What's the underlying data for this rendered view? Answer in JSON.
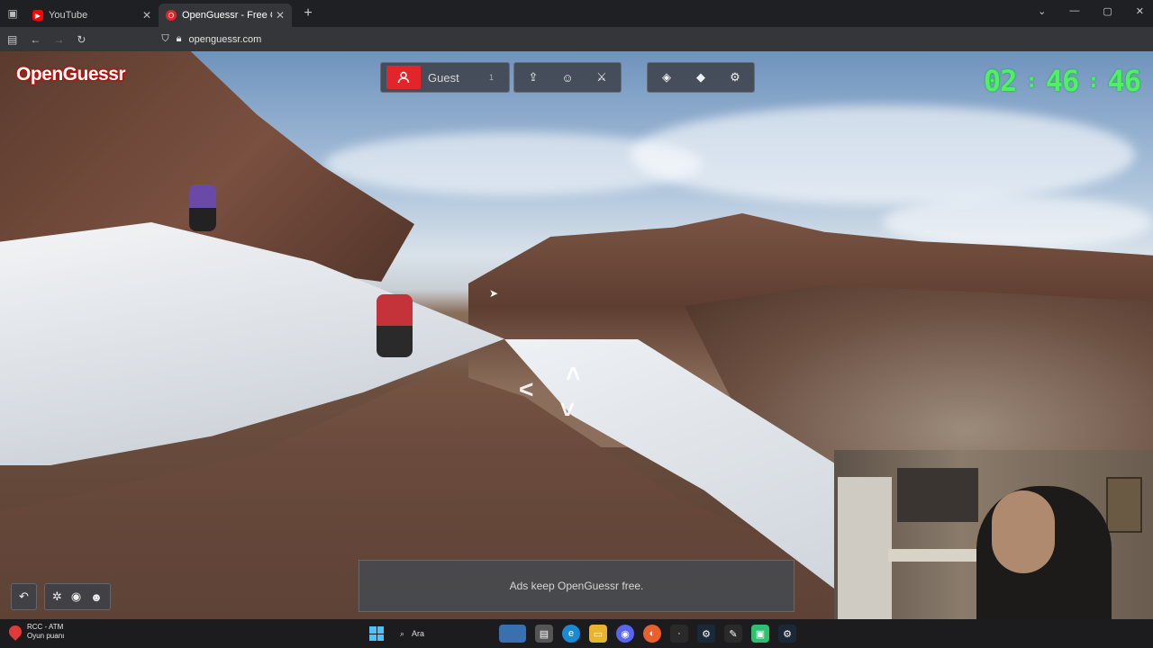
{
  "browser": {
    "tabs": [
      {
        "title": "YouTube",
        "active": false,
        "icon": "youtube-icon",
        "color": "#ff0000"
      },
      {
        "title": "OpenGuessr - Free GeoGuessr A",
        "active": true,
        "icon": "opera-icon",
        "color": "#e3242b"
      }
    ],
    "url": "openguessr.com"
  },
  "game": {
    "logo": "OpenGuessr",
    "player_name": "Guest",
    "player_count": "1",
    "ads_text": "Ads keep OpenGuessr free.",
    "accent": "#e3242b"
  },
  "timer": {
    "hours": "02",
    "minutes": "46",
    "seconds": "46",
    "color": "#4ff061"
  },
  "taskbar": {
    "news_title": "RCC - ATM",
    "news_sub": "Oyun puanı",
    "search_label": "Ara"
  }
}
